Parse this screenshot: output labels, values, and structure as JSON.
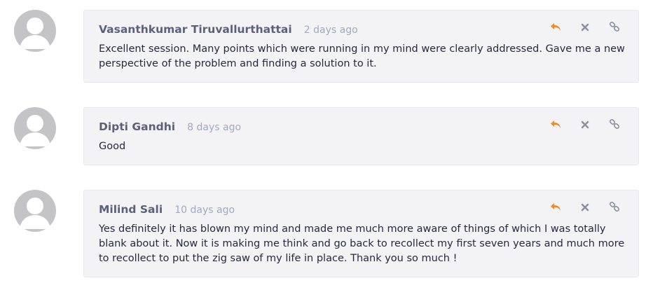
{
  "colors": {
    "reply_icon": "#f08a24",
    "action_icon": "#8a8d9e",
    "author": "#5d6078",
    "timestamp": "#a4a8c0",
    "bubble_bg": "#f3f3f6",
    "avatar_bg": "#c4c4c6"
  },
  "icons": {
    "reply": "reply-arrow",
    "delete": "close-x",
    "link": "link-chain",
    "avatar": "user-placeholder"
  },
  "comments": [
    {
      "author": "Vasanthkumar Tiruvallurthattai",
      "time": "2 days ago",
      "text": "Excellent  session. Many points which were running in my mind were clearly addressed. Gave me a new perspective of the problem and finding a solution to it."
    },
    {
      "author": "Dipti Gandhi",
      "time": "8 days ago",
      "text": "Good"
    },
    {
      "author": "Milind Sali",
      "time": "10 days ago",
      "text": "Yes definitely it has blown my mind and made me much more aware of things of which I was totally blank about it. Now it is making me think and go back to recollect my first seven years and much more to recollect to put the zig saw of my life in place. Thank you so much !"
    }
  ]
}
